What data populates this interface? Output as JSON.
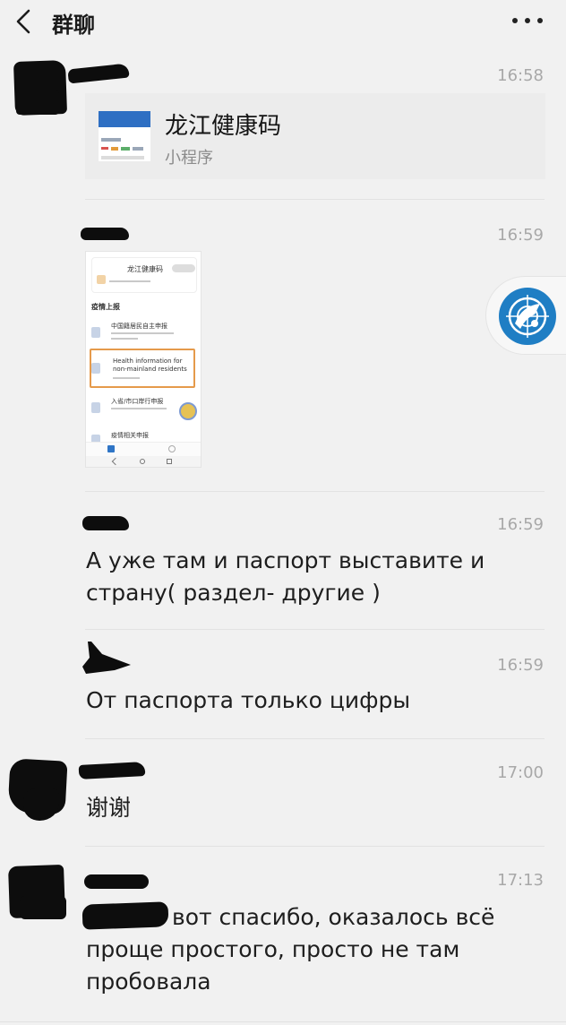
{
  "header": {
    "title": "群聊"
  },
  "messages": [
    {
      "time": "16:58",
      "mini_program": {
        "title": "龙江健康码",
        "subtitle": "小程序"
      }
    },
    {
      "time": "16:59",
      "screenshot": {
        "app_title": "龙江健康码",
        "section": "疫情上报",
        "items": [
          "中国籍居民自主申报",
          "Health information for non-mainland residents",
          "入省/市口岸行申报",
          "疫情相关申报"
        ]
      }
    },
    {
      "time": "16:59",
      "text": "А уже там и паспорт выставите и страну( раздел- другие )"
    },
    {
      "time": "16:59",
      "text": "От паспорта только цифры"
    },
    {
      "time": "17:00",
      "text": "谢谢"
    },
    {
      "time": "17:13",
      "text": "вот спасибо, оказалось всё проще простого, просто не там пробовала"
    }
  ],
  "icons": {
    "back": "chevron-left-icon",
    "more": "more-dots-icon",
    "float": "radar-satellite-icon"
  },
  "colors": {
    "background": "#f1f1f1",
    "time": "#a8a8a8",
    "accent": "#1f7ec4"
  }
}
